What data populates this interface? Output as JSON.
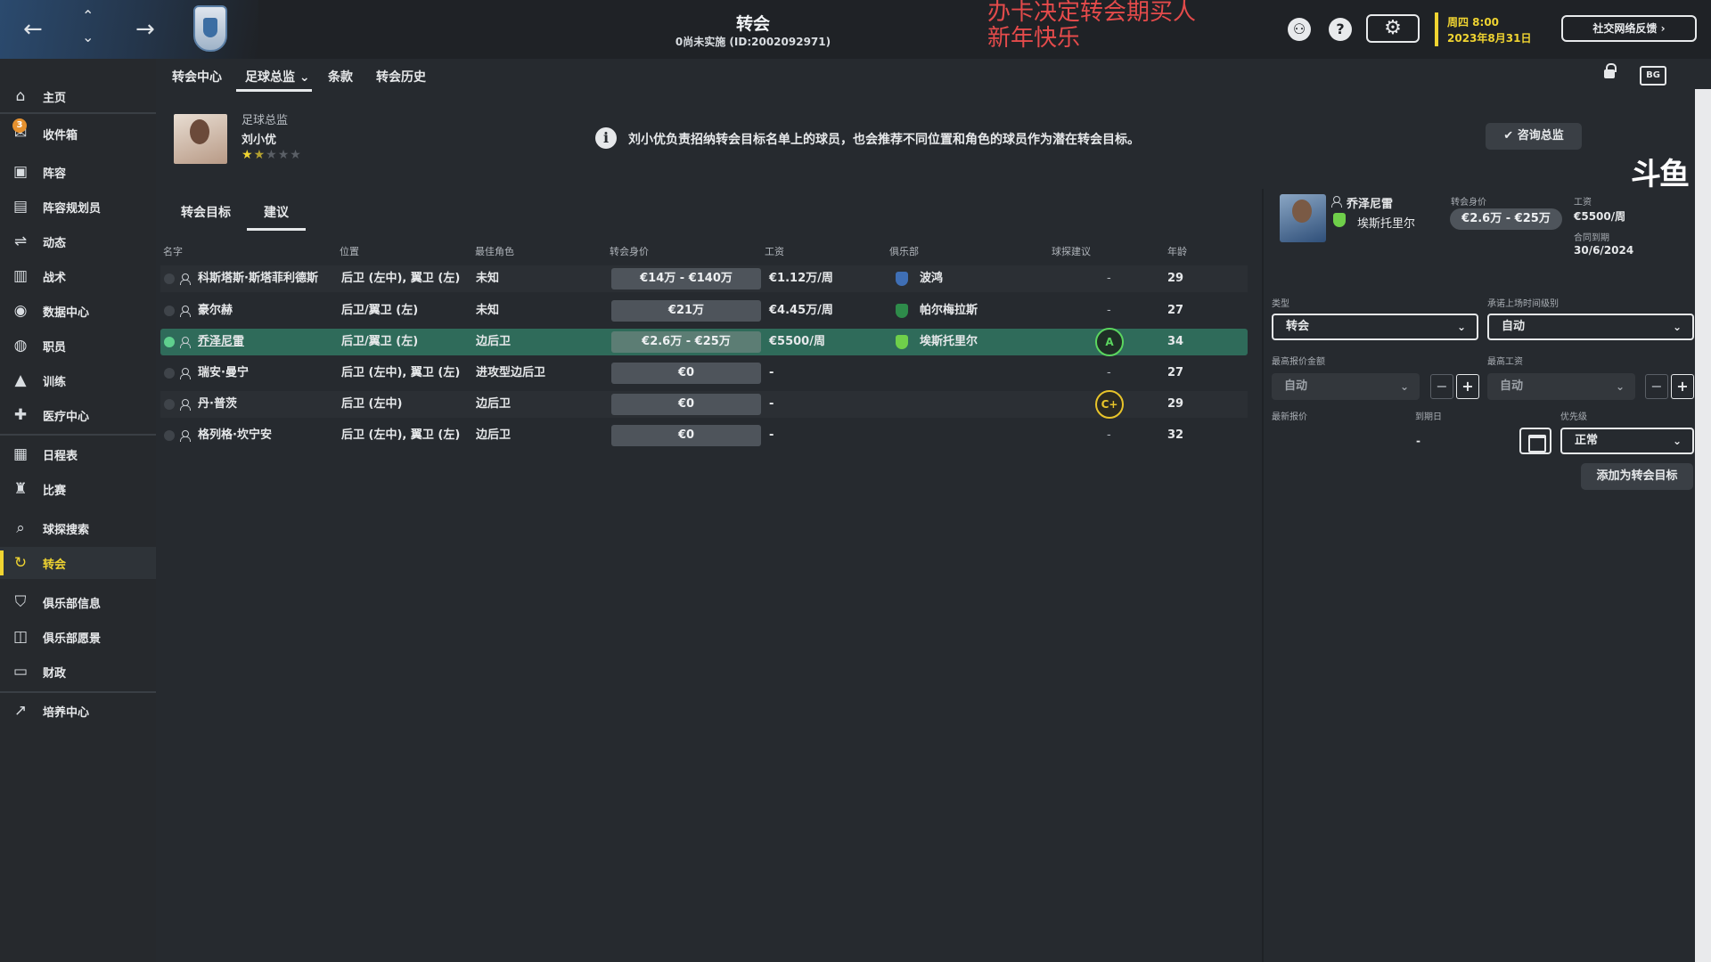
{
  "header": {
    "title": "转会",
    "subtitle": "0尚未实施 (ID:200209297​1)",
    "overlay_line1": "办卡决定转会期买人",
    "overlay_line2": "新年快乐",
    "date_line1": "周四 8:00",
    "date_line2": "2023年8月31日",
    "feedback_label": "社交网络反馈",
    "icons": [
      "back-arrow-icon",
      "up-chevron-icon",
      "down-chevron-icon",
      "forward-arrow-icon",
      "brain-icon",
      "help-icon",
      "gear-icon"
    ]
  },
  "sidebar": {
    "inbox_badge": "3",
    "items": [
      {
        "label": "主页",
        "icon": "home-icon"
      },
      {
        "label": "收件箱",
        "icon": "inbox-icon"
      },
      {
        "label": "阵容",
        "icon": "shirt-icon"
      },
      {
        "label": "阵容规划员",
        "icon": "clipboard-icon"
      },
      {
        "label": "动态",
        "icon": "dynamics-icon"
      },
      {
        "label": "战术",
        "icon": "tactics-icon"
      },
      {
        "label": "数据中心",
        "icon": "data-icon"
      },
      {
        "label": "职员",
        "icon": "staff-icon"
      },
      {
        "label": "训练",
        "icon": "training-icon"
      },
      {
        "label": "医疗中心",
        "icon": "medical-icon"
      },
      {
        "label": "日程表",
        "icon": "calendar-icon"
      },
      {
        "label": "比赛",
        "icon": "trophy-icon"
      },
      {
        "label": "球探搜索",
        "icon": "search-icon"
      },
      {
        "label": "转会",
        "icon": "transfer-icon"
      },
      {
        "label": "俱乐部信息",
        "icon": "shield-icon"
      },
      {
        "label": "俱乐部愿景",
        "icon": "vision-icon"
      },
      {
        "label": "财政",
        "icon": "finance-icon"
      },
      {
        "label": "培养中心",
        "icon": "development-icon"
      }
    ]
  },
  "subnav": {
    "items": [
      "转会中心",
      "足球总监",
      "条款",
      "转会历史"
    ],
    "dropdown_arrow": "⌄",
    "lock_icon": "lock-icon",
    "bg_icon_label": "BG"
  },
  "director": {
    "role": "足球总监",
    "name": "刘小优",
    "rating_stars": 1.5,
    "info_text": "刘小优负责招纳转会目标名单上的球员，也会推荐不同位置和角色的球员作为潜在转会目标。",
    "consult_label": "✔ 咨询总监"
  },
  "tabs": [
    "转会目标",
    "建议"
  ],
  "table": {
    "headers": [
      "名字",
      "位置",
      "最佳角色",
      "转会身价",
      "工资",
      "俱乐部",
      "球探建议",
      "年龄"
    ],
    "rows": [
      {
        "name": "科斯塔斯·斯塔菲利德斯",
        "position": "后卫 (左中), 翼卫 (左)",
        "role": "未知",
        "fee": "€14万 - €140万",
        "wage": "€1.12万/周",
        "club": "波鸿",
        "club_color": "#3f6fb5",
        "scout": "-",
        "age": "29"
      },
      {
        "name": "豪尔赫",
        "position": "后卫/翼卫 (左)",
        "role": "未知",
        "fee": "€21万",
        "wage": "€4.45万/周",
        "club": "帕尔梅拉斯",
        "club_color": "#2e8b4a",
        "scout": "-",
        "age": "27"
      },
      {
        "name": "乔泽尼雷",
        "position": "后卫/翼卫 (左)",
        "role": "边后卫",
        "fee": "€2.6万 - €25万",
        "wage": "€5500/周",
        "club": "埃斯托里尔",
        "club_color": "#6fcf4a",
        "scout": "A",
        "age": "34",
        "selected": true
      },
      {
        "name": "瑞安·曼宁",
        "position": "后卫 (左中), 翼卫 (左)",
        "role": "进攻型边后卫",
        "fee": "€0",
        "wage": "-",
        "club": "",
        "scout": "-",
        "age": "27"
      },
      {
        "name": "丹·普茨",
        "position": "后卫 (左中)",
        "role": "边后卫",
        "fee": "€0",
        "wage": "-",
        "club": "",
        "scout": "C+",
        "age": "29"
      },
      {
        "name": "格列格·坎宁安",
        "position": "后卫 (左中), 翼卫 (左)",
        "role": "边后卫",
        "fee": "€0",
        "wage": "-",
        "club": "",
        "scout": "-",
        "age": "32"
      }
    ]
  },
  "right_panel": {
    "player_name": "乔泽尼雷",
    "player_club": "埃斯托里尔",
    "fee_label": "转会身价",
    "fee_value": "€2.6万 - €25万",
    "wage_label": "工资",
    "wage_value": "€5500/周",
    "contract_label": "合同到期",
    "contract_value": "30/6/2024",
    "type_label": "类型",
    "type_value": "转会",
    "playtime_label": "承诺上场时间级别",
    "playtime_value": "自动",
    "max_bid_label": "最高报价金额",
    "max_bid_value": "自动",
    "max_wage_label": "最高工资",
    "max_wage_value": "自动",
    "latest_bid_label": "最新报价",
    "latest_bid_value": "-",
    "deadline_label": "到期日",
    "priority_label": "优先级",
    "priority_value": "正常",
    "add_target_label": "添加为转会目标",
    "minus": "−",
    "plus": "+"
  },
  "watermark": "斗鱼"
}
